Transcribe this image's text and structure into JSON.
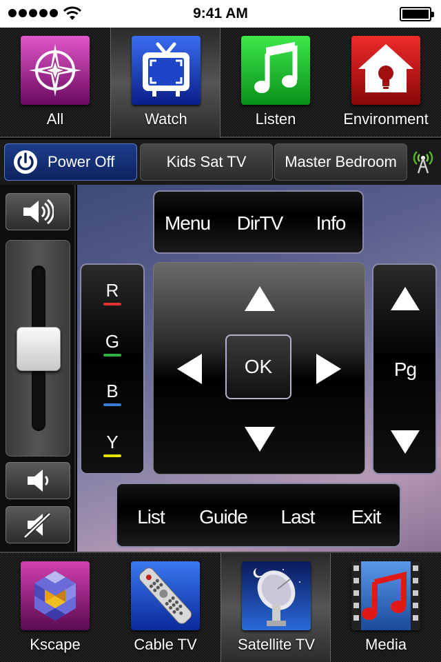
{
  "status_bar": {
    "time": "9:41 AM"
  },
  "top_nav": [
    {
      "label": "All",
      "icon": "compass-icon",
      "active": false
    },
    {
      "label": "Watch",
      "icon": "tv-icon",
      "active": true
    },
    {
      "label": "Listen",
      "icon": "music-note-icon",
      "active": false
    },
    {
      "label": "Environment",
      "icon": "house-bulb-icon",
      "active": false
    }
  ],
  "room_bar": {
    "power_label": "Power Off",
    "kids_label": "Kids Sat TV",
    "master_label": "Master Bedroom"
  },
  "remote": {
    "menu": "Menu",
    "dirtv": "DirTV",
    "info": "Info",
    "ok": "OK",
    "pg": "Pg",
    "r": "R",
    "g": "G",
    "b": "B",
    "y": "Y",
    "list": "List",
    "guide": "Guide",
    "last": "Last",
    "exit": "Exit"
  },
  "volume_level": 0.5,
  "colors": {
    "red": "#e03030",
    "green": "#30b040",
    "blue": "#3a7bd5",
    "yellow": "#e8e000",
    "power_blue": "#1d3e8a"
  },
  "bottom_nav": [
    {
      "label": "Kscape",
      "icon": "kscape-logo-icon",
      "active": false
    },
    {
      "label": "Cable TV",
      "icon": "remote-control-icon",
      "active": false
    },
    {
      "label": "Satellite TV",
      "icon": "satellite-dish-icon",
      "active": true
    },
    {
      "label": "Media",
      "icon": "film-music-icon",
      "active": false
    }
  ]
}
